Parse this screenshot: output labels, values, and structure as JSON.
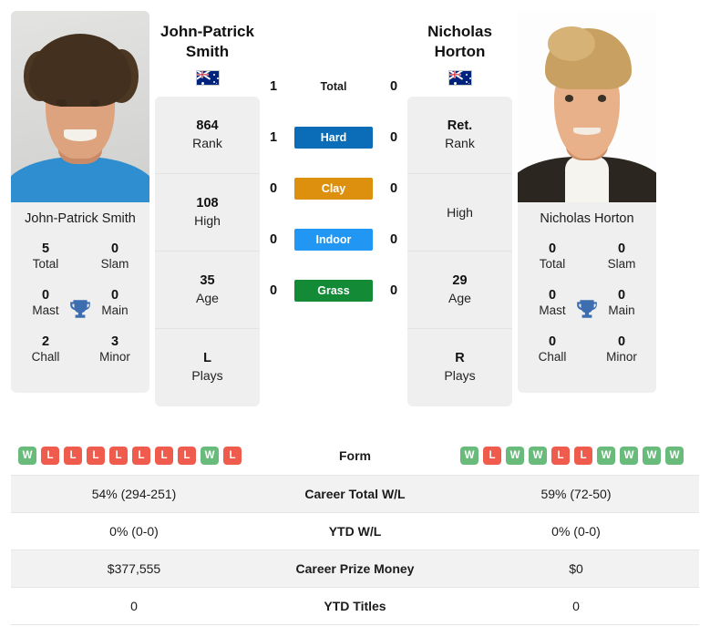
{
  "players": {
    "left": {
      "name_line1": "John-Patrick",
      "name_line2": "Smith",
      "photo_caption": "John-Patrick Smith",
      "country": "Australia",
      "flag_icon": "australia-flag-icon",
      "info": [
        {
          "value": "864",
          "label": "Rank"
        },
        {
          "value": "108",
          "label": "High"
        },
        {
          "value": "35",
          "label": "Age"
        },
        {
          "value": "L",
          "label": "Plays"
        }
      ],
      "titles": [
        {
          "value": "5",
          "label": "Total"
        },
        {
          "value": "0",
          "label": "Slam"
        },
        {
          "value": "0",
          "label": "Mast"
        },
        {
          "value": "0",
          "label": "Main"
        },
        {
          "value": "2",
          "label": "Chall"
        },
        {
          "value": "3",
          "label": "Minor"
        }
      ],
      "form": [
        "W",
        "L",
        "L",
        "L",
        "L",
        "L",
        "L",
        "L",
        "W",
        "L"
      ]
    },
    "right": {
      "name_line1": "Nicholas",
      "name_line2": "Horton",
      "photo_caption": "Nicholas Horton",
      "country": "Australia",
      "flag_icon": "australia-flag-icon",
      "info": [
        {
          "value": "Ret.",
          "label": "Rank"
        },
        {
          "value": "",
          "label": "High"
        },
        {
          "value": "29",
          "label": "Age"
        },
        {
          "value": "R",
          "label": "Plays"
        }
      ],
      "titles": [
        {
          "value": "0",
          "label": "Total"
        },
        {
          "value": "0",
          "label": "Slam"
        },
        {
          "value": "0",
          "label": "Mast"
        },
        {
          "value": "0",
          "label": "Main"
        },
        {
          "value": "0",
          "label": "Chall"
        },
        {
          "value": "0",
          "label": "Minor"
        }
      ],
      "form": [
        "W",
        "L",
        "W",
        "W",
        "L",
        "L",
        "W",
        "W",
        "W",
        "W"
      ]
    }
  },
  "trophy_icon": "trophy-icon",
  "h2h": [
    {
      "surface": "Total",
      "left": "1",
      "right": "0",
      "color": "",
      "plain": true
    },
    {
      "surface": "Hard",
      "left": "1",
      "right": "0",
      "color": "#0b6cb8",
      "plain": false
    },
    {
      "surface": "Clay",
      "left": "0",
      "right": "0",
      "color": "#dd900d",
      "plain": false
    },
    {
      "surface": "Indoor",
      "left": "0",
      "right": "0",
      "color": "#2196f3",
      "plain": false
    },
    {
      "surface": "Grass",
      "left": "0",
      "right": "0",
      "color": "#128a36",
      "plain": false
    }
  ],
  "table": {
    "rows": [
      {
        "label": "Form",
        "left": "",
        "right": "",
        "type": "form",
        "shaded": false
      },
      {
        "label": "Career Total W/L",
        "left": "54% (294-251)",
        "right": "59% (72-50)",
        "type": "text",
        "shaded": true
      },
      {
        "label": "YTD W/L",
        "left": "0% (0-0)",
        "right": "0% (0-0)",
        "type": "text",
        "shaded": false
      },
      {
        "label": "Career Prize Money",
        "left": "$377,555",
        "right": "$0",
        "type": "text",
        "shaded": true
      },
      {
        "label": "YTD Titles",
        "left": "0",
        "right": "0",
        "type": "text",
        "shaded": false
      }
    ]
  },
  "colors": {
    "win_badge": "#69bb7b",
    "loss_badge": "#ef5b4c",
    "card_bg": "#efefef",
    "row_shade": "#f2f2f2",
    "trophy": "#3d6fb0"
  }
}
